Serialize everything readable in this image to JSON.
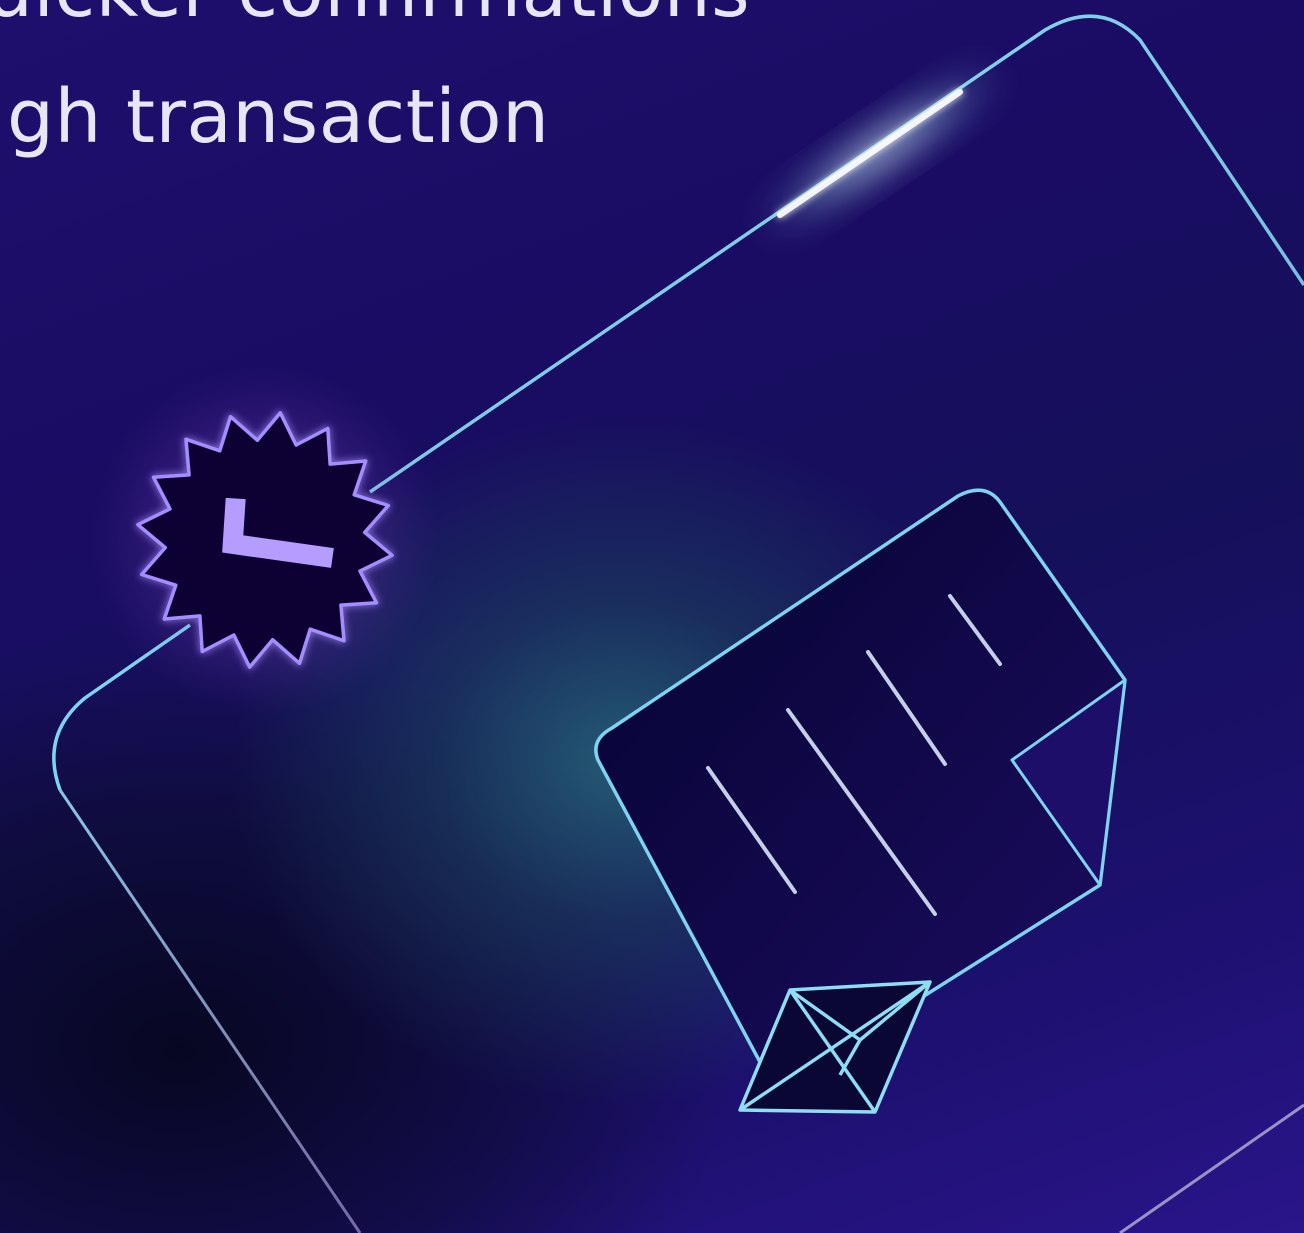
{
  "heading": {
    "line_1": "uicker confirmations",
    "line_2": "igh transaction"
  },
  "illustration": {
    "card_outline": "card-frame",
    "badge_icon": "verified-check-badge-icon",
    "document_icon": "document-icon",
    "ethereum_icon": "ethereum-diamond-icon"
  },
  "colors": {
    "background": "#1a0c63",
    "card_stroke": "#7fd3f0",
    "glow": "#e9fbff",
    "badge_fill": "#0a0630",
    "badge_stroke": "#a58cff",
    "check": "#b59cff",
    "text": "#e8e6f5"
  }
}
